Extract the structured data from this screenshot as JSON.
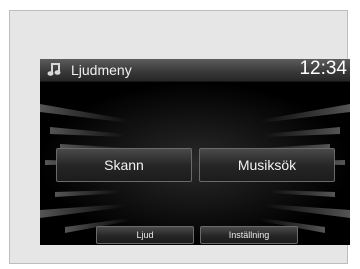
{
  "header": {
    "title": "Ljudmeny",
    "clock": "12:34",
    "icon": "music-note-icon"
  },
  "main_buttons": {
    "scan_label": "Skann",
    "music_search_label": "Musiksök"
  },
  "bottom_buttons": {
    "sound_label": "Ljud",
    "settings_label": "Inställning"
  },
  "colors": {
    "screen_bg": "#000000",
    "header_bg": "#3a3a3a",
    "button_border": "#6a6a6a",
    "text": "#f2f2f2"
  }
}
